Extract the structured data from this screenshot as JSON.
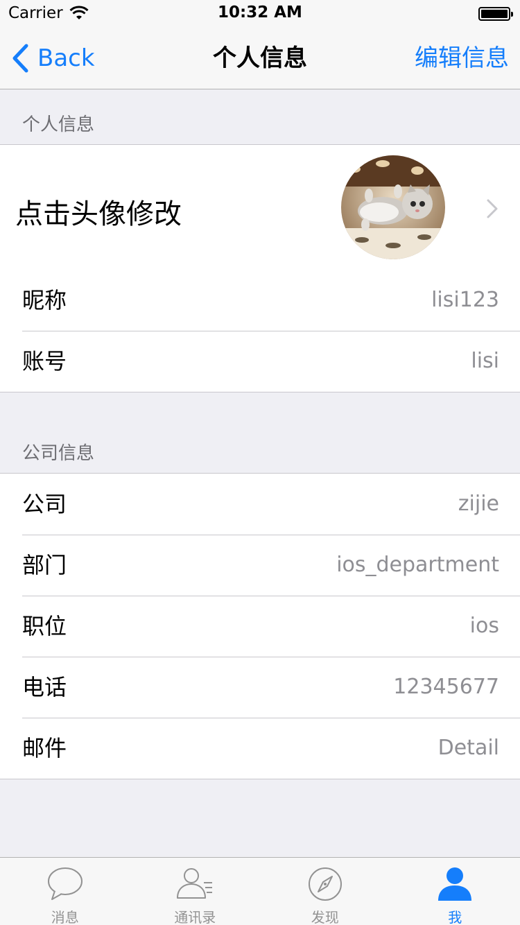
{
  "status_bar": {
    "carrier": "Carrier",
    "time": "10:32 AM"
  },
  "nav": {
    "back_label": "Back",
    "title": "个人信息",
    "edit_label": "编辑信息"
  },
  "personal_section": {
    "header": "个人信息",
    "avatar_label": "点击头像修改",
    "rows": [
      {
        "label": "昵称",
        "value": "lisi123"
      },
      {
        "label": "账号",
        "value": "lisi"
      }
    ]
  },
  "company_section": {
    "header": "公司信息",
    "rows": [
      {
        "label": "公司",
        "value": "zijie"
      },
      {
        "label": "部门",
        "value": "ios_department"
      },
      {
        "label": "职位",
        "value": "ios"
      },
      {
        "label": "电话",
        "value": "12345677"
      },
      {
        "label": "邮件",
        "value": "Detail"
      }
    ]
  },
  "tabbar": {
    "tabs": [
      {
        "label": "消息",
        "icon": "chat-bubble-icon",
        "active": false
      },
      {
        "label": "通讯录",
        "icon": "contacts-icon",
        "active": false
      },
      {
        "label": "发现",
        "icon": "compass-icon",
        "active": false
      },
      {
        "label": "我",
        "icon": "person-icon",
        "active": true
      }
    ]
  },
  "colors": {
    "accent": "#157efb",
    "background": "#efeff4",
    "secondary_text": "#8e8e93",
    "tab_inactive": "#929292"
  }
}
